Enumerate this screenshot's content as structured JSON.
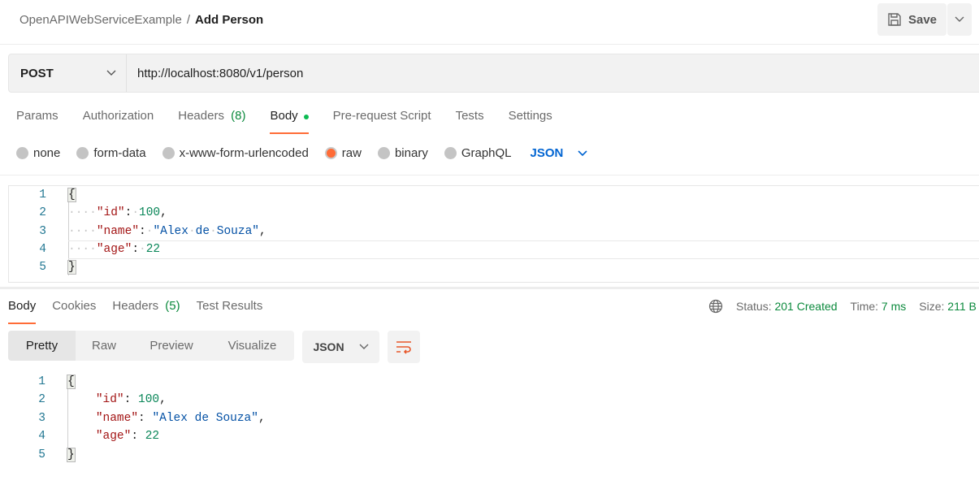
{
  "header": {
    "collection": "OpenAPIWebServiceExample",
    "separator": "/",
    "request_name": "Add Person",
    "save_label": "Save"
  },
  "request": {
    "method": "POST",
    "url": "http://localhost:8080/v1/person"
  },
  "request_tabs": [
    {
      "label": "Params"
    },
    {
      "label": "Authorization"
    },
    {
      "label": "Headers",
      "count": "(8)"
    },
    {
      "label": "Body",
      "active": true
    },
    {
      "label": "Pre-request Script"
    },
    {
      "label": "Tests"
    },
    {
      "label": "Settings"
    }
  ],
  "body_modes": [
    {
      "label": "none"
    },
    {
      "label": "form-data"
    },
    {
      "label": "x-www-form-urlencoded"
    },
    {
      "label": "raw",
      "selected": true
    },
    {
      "label": "binary"
    },
    {
      "label": "GraphQL"
    }
  ],
  "body_format": "JSON",
  "request_body": {
    "line_numbers": [
      "1",
      "2",
      "3",
      "4",
      "5"
    ],
    "lines": [
      "{",
      "\"id\": 100,",
      "\"name\": \"Alex de Souza\",",
      "\"age\": 22",
      "}"
    ]
  },
  "response_tabs": [
    {
      "label": "Body",
      "active": true
    },
    {
      "label": "Cookies"
    },
    {
      "label": "Headers",
      "count": "(5)"
    },
    {
      "label": "Test Results"
    }
  ],
  "response_meta": {
    "status_label": "Status:",
    "status": "201 Created",
    "time_label": "Time:",
    "time": "7 ms",
    "size_label": "Size:",
    "size": "211 B"
  },
  "view_modes": [
    "Pretty",
    "Raw",
    "Preview",
    "Visualize"
  ],
  "response_format": "JSON",
  "response_body": {
    "line_numbers": [
      "1",
      "2",
      "3",
      "4",
      "5"
    ]
  },
  "colors": {
    "accent": "#ff6c37",
    "success": "#0c8a3d",
    "link": "#0265d2",
    "json_key": "#a31515",
    "json_number": "#098658",
    "json_string": "#0451a5"
  },
  "icons": {
    "save": "floppy-disk-icon",
    "dropdown": "chevron-down-icon",
    "network": "globe-icon",
    "wrap": "wrap-lines-icon"
  }
}
